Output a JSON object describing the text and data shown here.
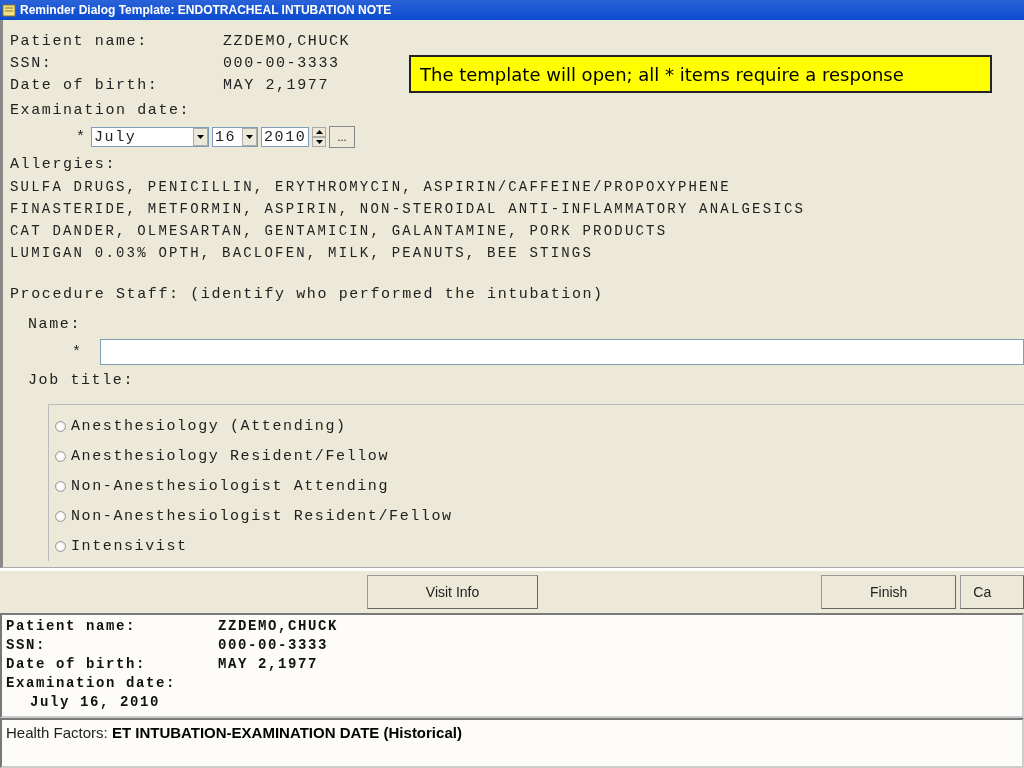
{
  "window": {
    "title": "Reminder Dialog Template: ENDOTRACHEAL INTUBATION NOTE"
  },
  "patient": [
    {
      "label": "Patient name:",
      "value": "ZZDEMO,CHUCK"
    },
    {
      "label": "SSN:",
      "value": "000-00-3333"
    },
    {
      "label": "Date of birth:",
      "value": "MAY 2,1977"
    }
  ],
  "callout": {
    "text": "The template will open; all * items require a response"
  },
  "exam_date": {
    "label": "Examination date:",
    "required": "*",
    "month": "July",
    "day": "16",
    "year": "2010",
    "button": "..."
  },
  "allergies": {
    "label": "Allergies:",
    "lines": [
      "SULFA DRUGS, PENICILLIN, ERYTHROMYCIN, ASPIRIN/CAFFEINE/PROPOXYPHENE",
      "FINASTERIDE, METFORMIN, ASPIRIN, NON-STEROIDAL ANTI-INFLAMMATORY ANALGESICS",
      "CAT DANDER, OLMESARTAN, GENTAMICIN, GALANTAMINE, PORK PRODUCTS",
      "LUMIGAN 0.03% OPTH, BACLOFEN, MILK, PEANUTS, BEE STINGS"
    ]
  },
  "procedure_staff": {
    "heading": "Procedure Staff: (identify who performed the intubation)",
    "name_label": "Name:",
    "name_required": "*",
    "job_title_label": "Job title:",
    "options": [
      {
        "label": "Anesthesiology (Attending)",
        "selected": false
      },
      {
        "label": "Anesthesiology Resident/Fellow",
        "selected": false
      },
      {
        "label": "Non-Anesthesiologist Attending",
        "selected": false
      },
      {
        "label": "Non-Anesthesiologist Resident/Fellow",
        "selected": false
      },
      {
        "label": "Intensivist",
        "selected": false
      }
    ]
  },
  "buttons": [
    {
      "label": "Visit Info",
      "kind": "left"
    },
    {
      "label": "Finish",
      "kind": "right"
    },
    {
      "label": "Ca",
      "kind": "right"
    }
  ],
  "preview": {
    "fields": [
      {
        "label": "Patient name:",
        "value": "ZZDEMO,CHUCK"
      },
      {
        "label": "SSN:",
        "value": "000-00-3333"
      },
      {
        "label": "Date of birth:",
        "value": "MAY 2,1977"
      }
    ],
    "exam_label": "Examination date:",
    "exam_value": "July 16, 2010"
  },
  "health_factors": {
    "label": "Health Factors:",
    "value": "ET INTUBATION-EXAMINATION DATE (Historical)"
  }
}
